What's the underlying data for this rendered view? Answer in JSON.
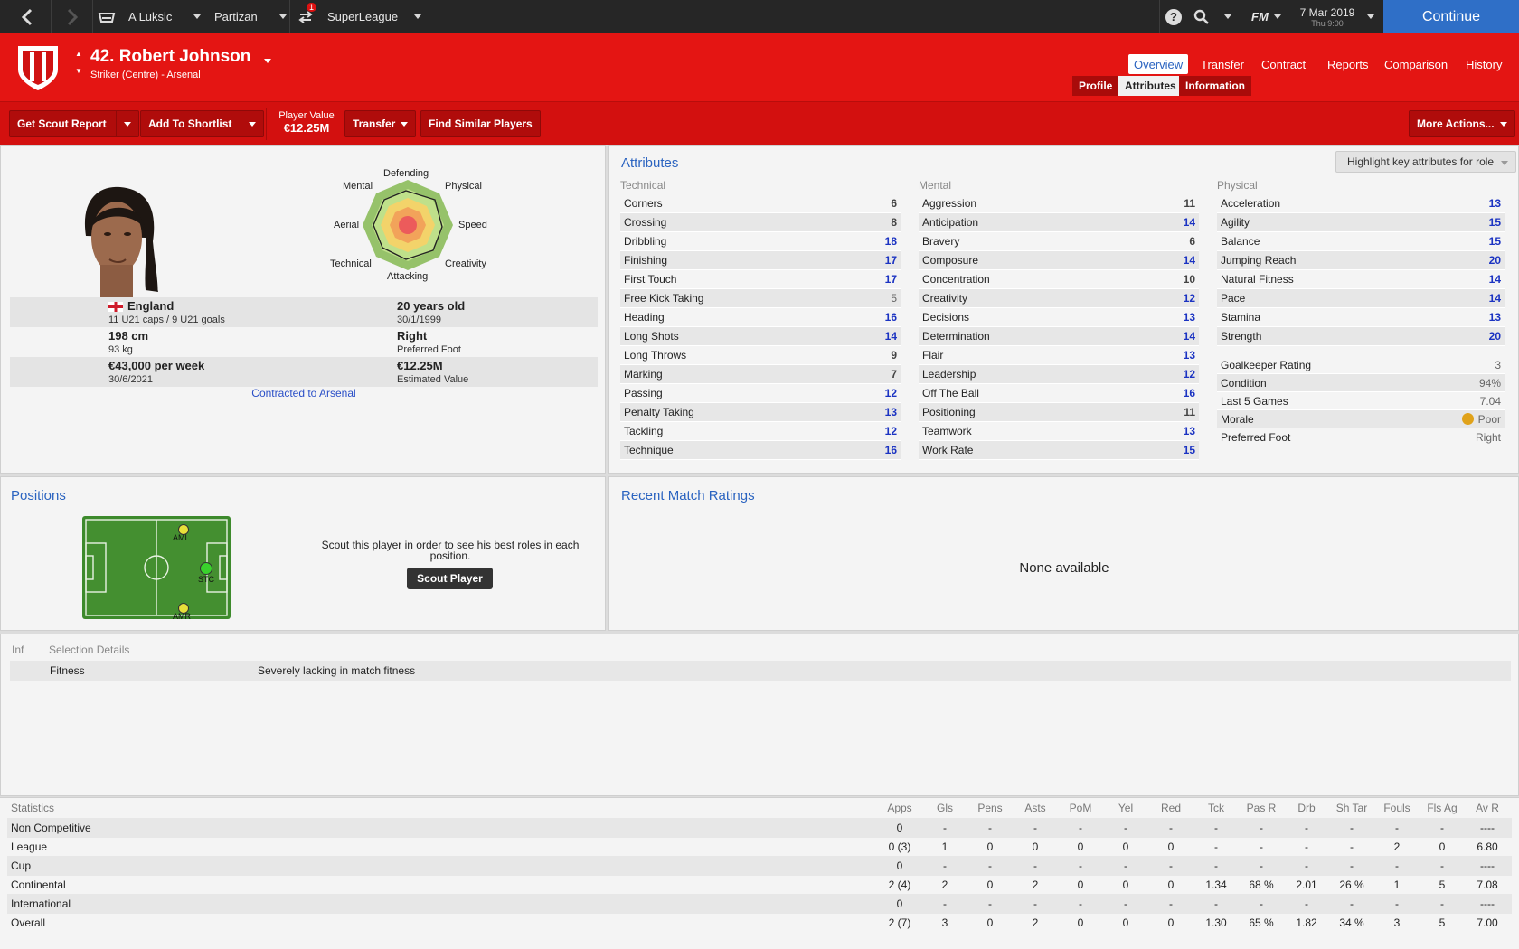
{
  "topbar": {
    "manager": "A Luksic",
    "club": "Partizan",
    "league": "SuperLeague",
    "notification_count": "1",
    "fm_label": "FM",
    "date": "7 Mar 2019",
    "time": "Thu 9:00",
    "continue_label": "Continue"
  },
  "player": {
    "name": "42. Robert Johnson",
    "position": "Striker (Centre) - Arsenal"
  },
  "nav": {
    "tabs": [
      "Overview",
      "Transfer",
      "Contract",
      "Reports",
      "Comparison",
      "History"
    ],
    "subtabs": [
      "Profile",
      "Attributes",
      "Information"
    ]
  },
  "actions": {
    "scout_report": "Get Scout Report",
    "shortlist": "Add To Shortlist",
    "value_label": "Player Value",
    "value": "€12.25M",
    "transfer": "Transfer",
    "similar": "Find Similar Players",
    "more": "More Actions..."
  },
  "profile": {
    "radar_labels": {
      "defending": "Defending",
      "physical": "Physical",
      "speed": "Speed",
      "creativity": "Creativity",
      "attacking": "Attacking",
      "technical": "Technical",
      "aerial": "Aerial",
      "mental": "Mental"
    },
    "nationality": "England",
    "caps": "11 U21 caps / 9 U21 goals",
    "age": "20 years old",
    "dob": "30/1/1999",
    "height": "198 cm",
    "weight": "93 kg",
    "foot": "Right",
    "foot_label": "Preferred Foot",
    "wage": "€43,000 per week",
    "contract_end": "30/6/2021",
    "est_value": "€12.25M",
    "est_value_label": "Estimated Value",
    "contracted": "Contracted to Arsenal"
  },
  "attributes": {
    "title": "Attributes",
    "highlight_btn": "Highlight key attributes for role",
    "technical_label": "Technical",
    "mental_label": "Mental",
    "physical_label": "Physical",
    "technical": [
      {
        "name": "Corners",
        "value": "6"
      },
      {
        "name": "Crossing",
        "value": "8"
      },
      {
        "name": "Dribbling",
        "value": "18"
      },
      {
        "name": "Finishing",
        "value": "17"
      },
      {
        "name": "First Touch",
        "value": "17"
      },
      {
        "name": "Free Kick Taking",
        "value": "5"
      },
      {
        "name": "Heading",
        "value": "16"
      },
      {
        "name": "Long Shots",
        "value": "14"
      },
      {
        "name": "Long Throws",
        "value": "9"
      },
      {
        "name": "Marking",
        "value": "7"
      },
      {
        "name": "Passing",
        "value": "12"
      },
      {
        "name": "Penalty Taking",
        "value": "13"
      },
      {
        "name": "Tackling",
        "value": "12"
      },
      {
        "name": "Technique",
        "value": "16"
      }
    ],
    "mental": [
      {
        "name": "Aggression",
        "value": "11"
      },
      {
        "name": "Anticipation",
        "value": "14"
      },
      {
        "name": "Bravery",
        "value": "6"
      },
      {
        "name": "Composure",
        "value": "14"
      },
      {
        "name": "Concentration",
        "value": "10"
      },
      {
        "name": "Creativity",
        "value": "12"
      },
      {
        "name": "Decisions",
        "value": "13"
      },
      {
        "name": "Determination",
        "value": "14"
      },
      {
        "name": "Flair",
        "value": "13"
      },
      {
        "name": "Leadership",
        "value": "12"
      },
      {
        "name": "Off The Ball",
        "value": "16"
      },
      {
        "name": "Positioning",
        "value": "11"
      },
      {
        "name": "Teamwork",
        "value": "13"
      },
      {
        "name": "Work Rate",
        "value": "15"
      }
    ],
    "physical": [
      {
        "name": "Acceleration",
        "value": "13"
      },
      {
        "name": "Agility",
        "value": "15"
      },
      {
        "name": "Balance",
        "value": "15"
      },
      {
        "name": "Jumping Reach",
        "value": "20"
      },
      {
        "name": "Natural Fitness",
        "value": "14"
      },
      {
        "name": "Pace",
        "value": "14"
      },
      {
        "name": "Stamina",
        "value": "13"
      },
      {
        "name": "Strength",
        "value": "20"
      }
    ],
    "extra": [
      {
        "name": "Goalkeeper Rating",
        "value": "3"
      },
      {
        "name": "Condition",
        "value": "94%"
      },
      {
        "name": "Last 5 Games",
        "value": "7.04"
      },
      {
        "name": "Morale",
        "value": "Poor"
      },
      {
        "name": "Preferred Foot",
        "value": "Right"
      }
    ]
  },
  "positions": {
    "title": "Positions",
    "markers": [
      "AML",
      "STC",
      "AMR"
    ],
    "scout_text": "Scout this player in order to see his best roles in each position.",
    "scout_btn": "Scout Player"
  },
  "ratings": {
    "title": "Recent Match Ratings",
    "empty": "None available"
  },
  "selection": {
    "inf_header": "Inf",
    "details_header": "Selection Details",
    "row_label": "Fitness",
    "row_value": "Severely lacking in match fitness"
  },
  "stats": {
    "headers": [
      "Statistics",
      "Apps",
      "Gls",
      "Pens",
      "Asts",
      "PoM",
      "Yel",
      "Red",
      "Tck",
      "Pas R",
      "Drb",
      "Sh Tar",
      "Fouls",
      "Fls Ag",
      "Av R"
    ],
    "rows": [
      [
        "Non Competitive",
        "0",
        "-",
        "-",
        "-",
        "-",
        "-",
        "-",
        "-",
        "-",
        "-",
        "-",
        "-",
        "-",
        "----"
      ],
      [
        "League",
        "0 (3)",
        "1",
        "0",
        "0",
        "0",
        "0",
        "0",
        "-",
        "-",
        "-",
        "-",
        "2",
        "0",
        "6.80"
      ],
      [
        "Cup",
        "0",
        "-",
        "-",
        "-",
        "-",
        "-",
        "-",
        "-",
        "-",
        "-",
        "-",
        "-",
        "-",
        "----"
      ],
      [
        "Continental",
        "2 (4)",
        "2",
        "0",
        "2",
        "0",
        "0",
        "0",
        "1.34",
        "68 %",
        "2.01",
        "26 %",
        "1",
        "5",
        "7.08"
      ],
      [
        "International",
        "0",
        "-",
        "-",
        "-",
        "-",
        "-",
        "-",
        "-",
        "-",
        "-",
        "-",
        "-",
        "-",
        "----"
      ],
      [
        "Overall",
        "2 (7)",
        "3",
        "0",
        "2",
        "0",
        "0",
        "0",
        "1.30",
        "65 %",
        "1.82",
        "34 %",
        "3",
        "5",
        "7.00"
      ]
    ]
  },
  "colors": {
    "brand_red": "#e41513",
    "accent_blue": "#2a63c0",
    "high_value": "#1b33c2"
  }
}
